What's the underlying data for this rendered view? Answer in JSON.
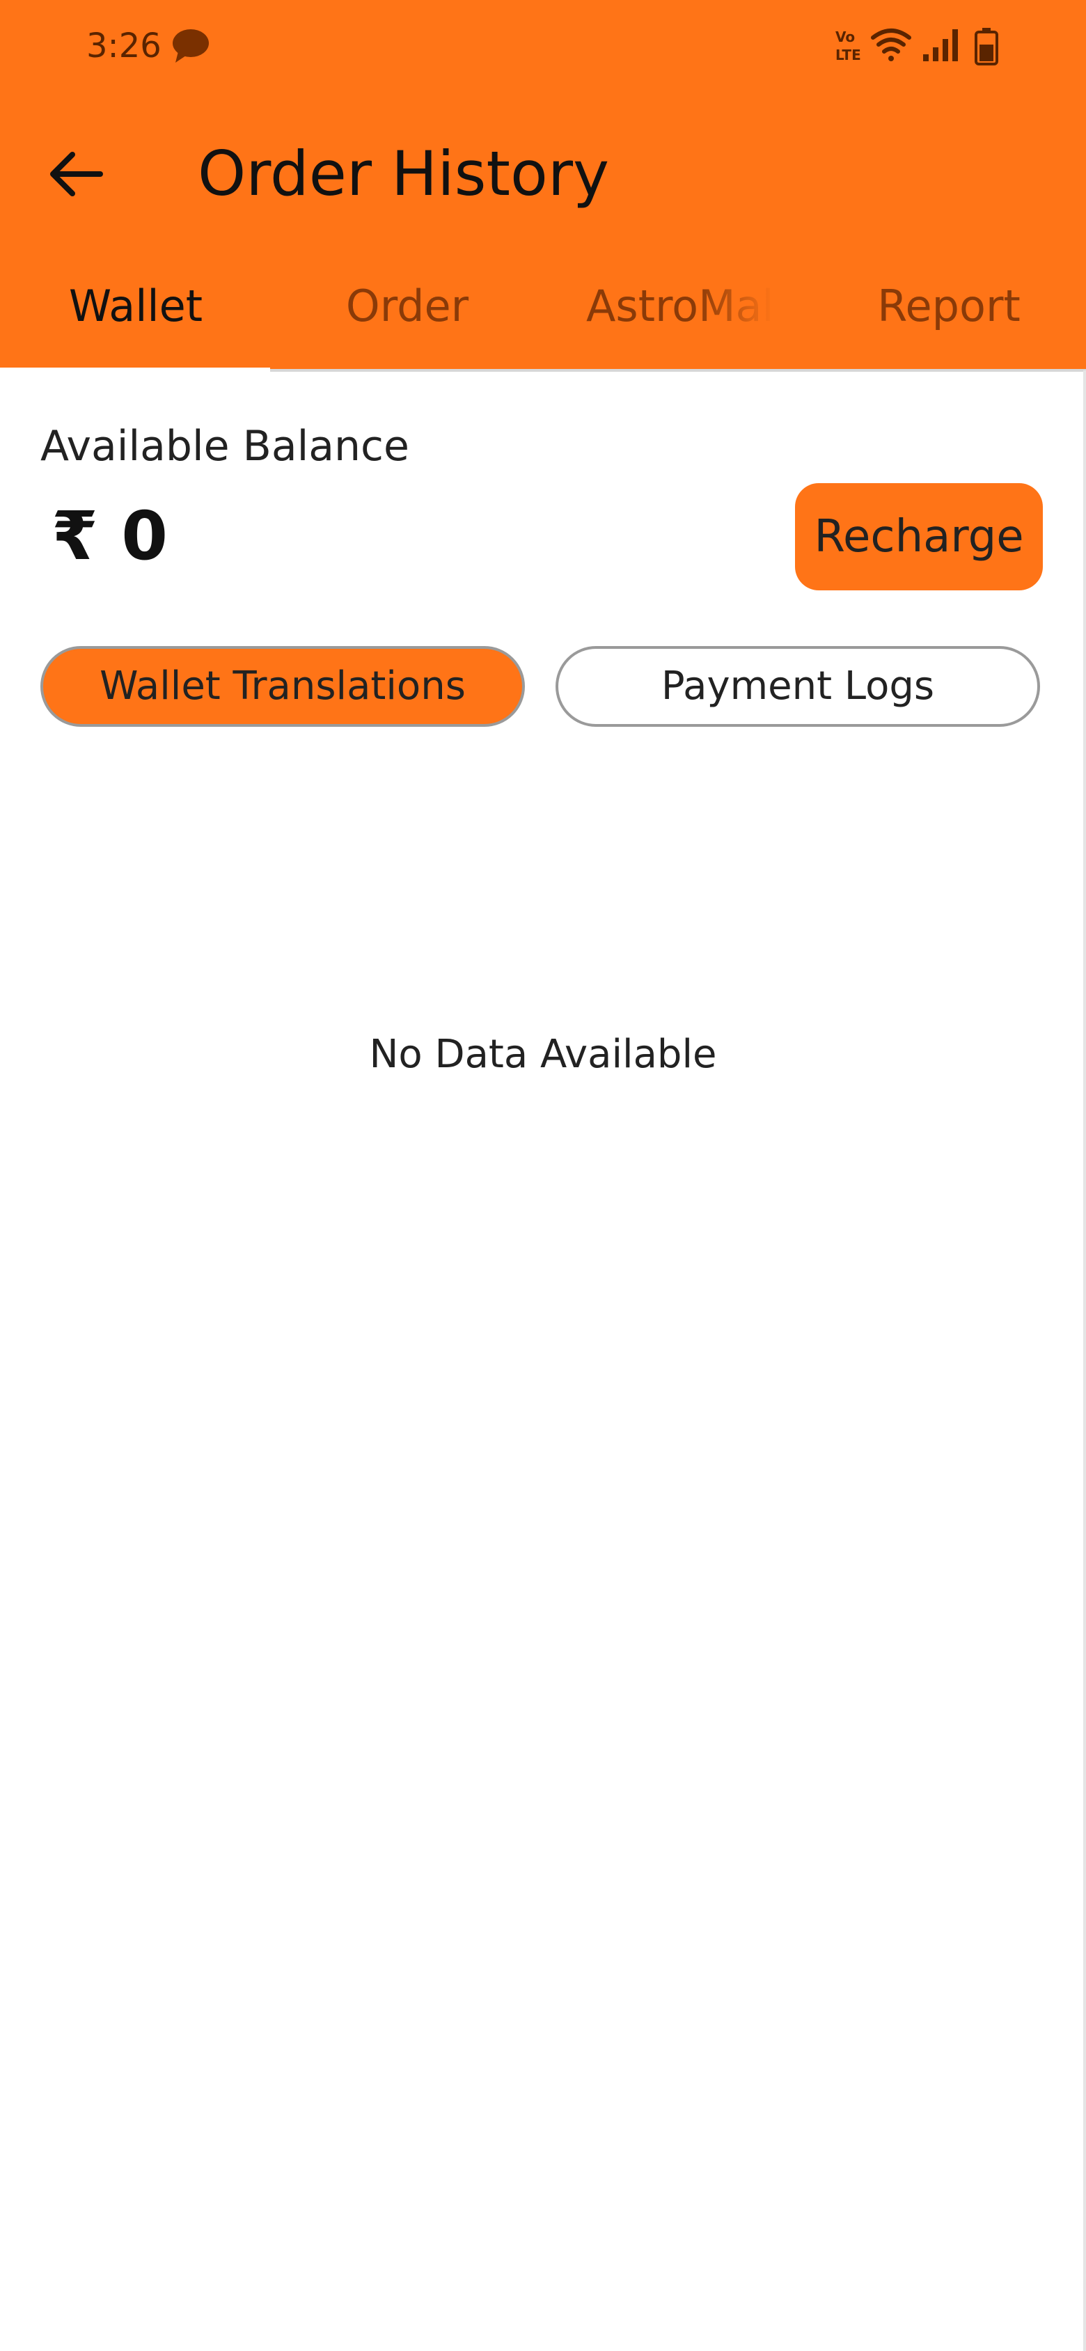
{
  "status_bar": {
    "time": "3:26",
    "icons": [
      "chat-bubble-icon",
      "volte-icon",
      "wifi-icon",
      "signal-icon",
      "battery-icon"
    ]
  },
  "toolbar": {
    "back_icon": "arrow-left-icon",
    "title": "Order History"
  },
  "tabs": [
    {
      "label": "Wallet",
      "active": true
    },
    {
      "label": "Order",
      "active": false
    },
    {
      "label": "AstroMall",
      "active": false
    },
    {
      "label": "Report",
      "active": false
    }
  ],
  "wallet": {
    "balance_label": "Available Balance",
    "balance_value": "₹ 0",
    "recharge_label": "Recharge"
  },
  "filters": [
    {
      "label": "Wallet Translations",
      "active": true
    },
    {
      "label": "Payment Logs",
      "active": false
    }
  ],
  "empty_state": "No Data Available",
  "colors": {
    "accent": "#ff7417",
    "status_text": "#5a2400"
  }
}
